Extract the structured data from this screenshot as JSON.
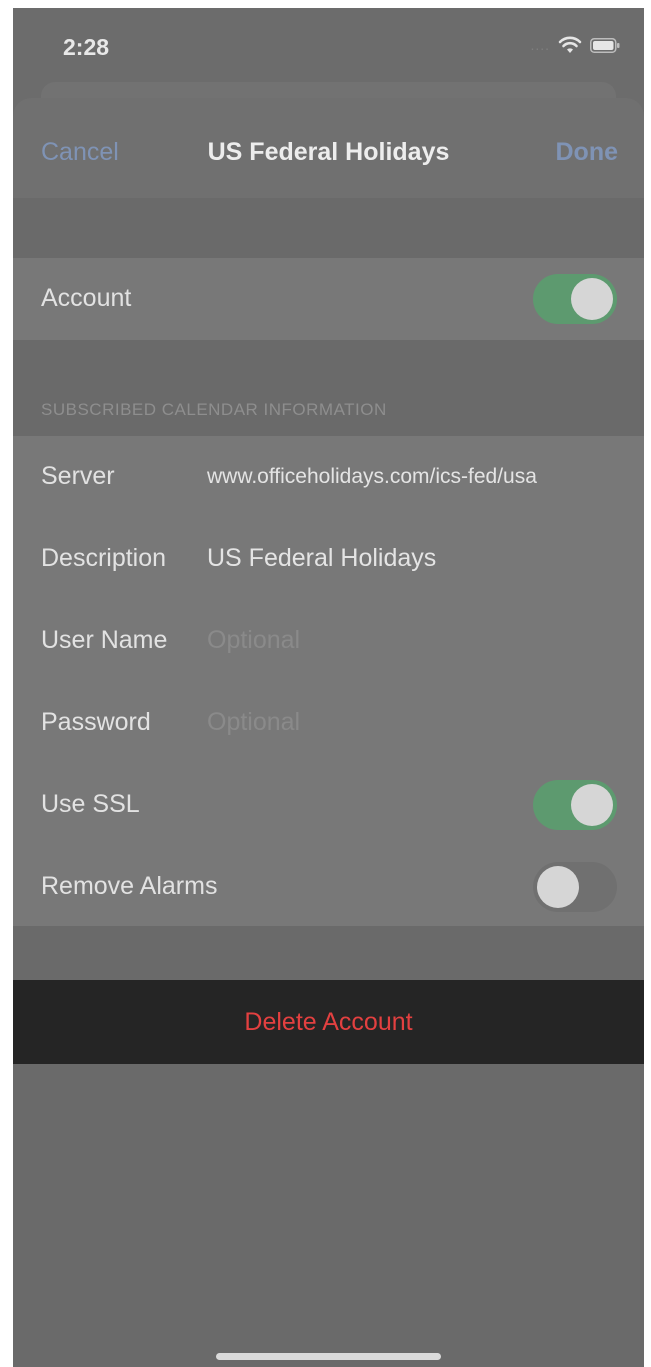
{
  "status_bar": {
    "time": "2:28",
    "signal": "....",
    "wifi_icon": "wifi-icon",
    "battery_icon": "battery-icon"
  },
  "nav": {
    "cancel_label": "Cancel",
    "title": "US Federal Holidays",
    "done_label": "Done"
  },
  "account": {
    "label": "Account",
    "enabled": true
  },
  "section": {
    "header": "SUBSCRIBED CALENDAR INFORMATION"
  },
  "fields": {
    "server": {
      "label": "Server",
      "value": "www.officeholidays.com/ics-fed/usa"
    },
    "description": {
      "label": "Description",
      "value": "US Federal Holidays"
    },
    "user_name": {
      "label": "User Name",
      "placeholder": "Optional"
    },
    "password": {
      "label": "Password",
      "placeholder": "Optional"
    },
    "use_ssl": {
      "label": "Use SSL",
      "enabled": true
    },
    "remove_alarms": {
      "label": "Remove Alarms",
      "enabled": false
    }
  },
  "delete": {
    "label": "Delete Account"
  },
  "colors": {
    "accent_blue": "#7f93b5",
    "toggle_on": "#5d9a6f",
    "destructive_red": "#e34040"
  }
}
